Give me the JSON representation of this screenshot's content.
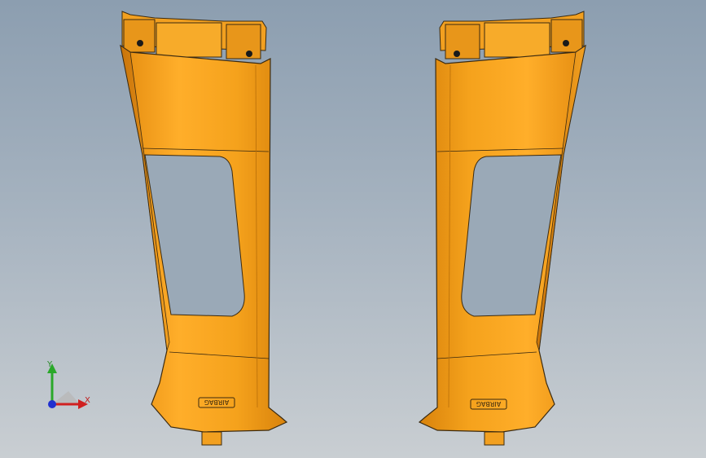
{
  "viewport": {
    "background_top": "#8c9eb0",
    "background_bottom": "#c9ced2"
  },
  "model": {
    "part_color": "#f5a21c",
    "part_shade": "#d9830c",
    "part_edge": "#3b2a10",
    "parts": [
      {
        "name": "pillar-trim-left",
        "emboss_text": "AIRBAG"
      },
      {
        "name": "pillar-trim-right",
        "emboss_text": "AIRBAG"
      }
    ]
  },
  "triad": {
    "y_label": "Y",
    "x_label": "X",
    "y_color": "#2aa82a",
    "x_color": "#d02020",
    "z_color": "#2030d0"
  }
}
